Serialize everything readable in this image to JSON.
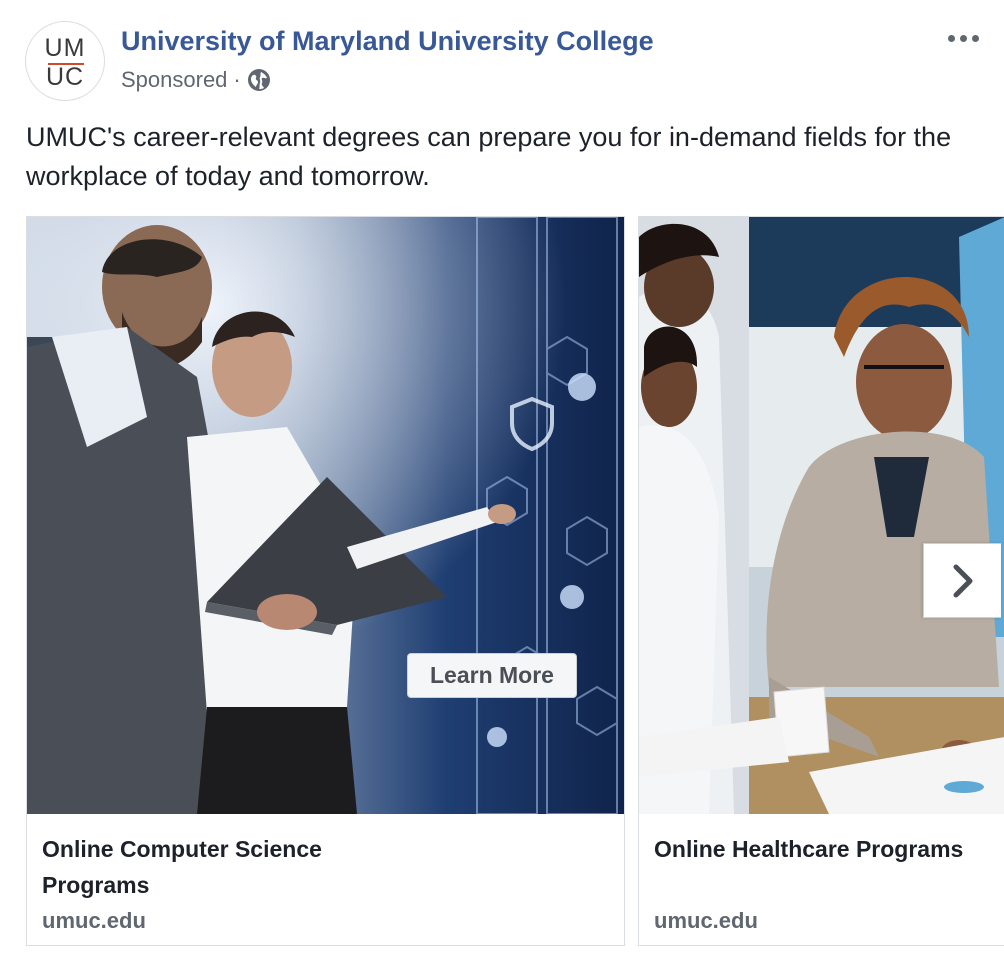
{
  "header": {
    "avatar_line1": "UM",
    "avatar_line2": "UC",
    "page_name": "University of Maryland University College",
    "sponsored": "Sponsored",
    "separator": "·",
    "privacy_icon": "globe-icon",
    "menu_icon": "more-options-icon"
  },
  "post": {
    "text": "UMUC's career-relevant degrees can prepare you for in-demand fields for the workplace of today and tomorrow."
  },
  "carousel": {
    "cards": [
      {
        "title": "Online Computer Science Programs",
        "domain": "umuc.edu",
        "cta": "Learn More"
      },
      {
        "title": "Online Healthcare Programs",
        "domain": "umuc.edu"
      }
    ],
    "next_icon": "chevron-right-icon"
  },
  "colors": {
    "link": "#385898",
    "secondary_text": "#606770",
    "brand_accent": "#d04a2b"
  }
}
